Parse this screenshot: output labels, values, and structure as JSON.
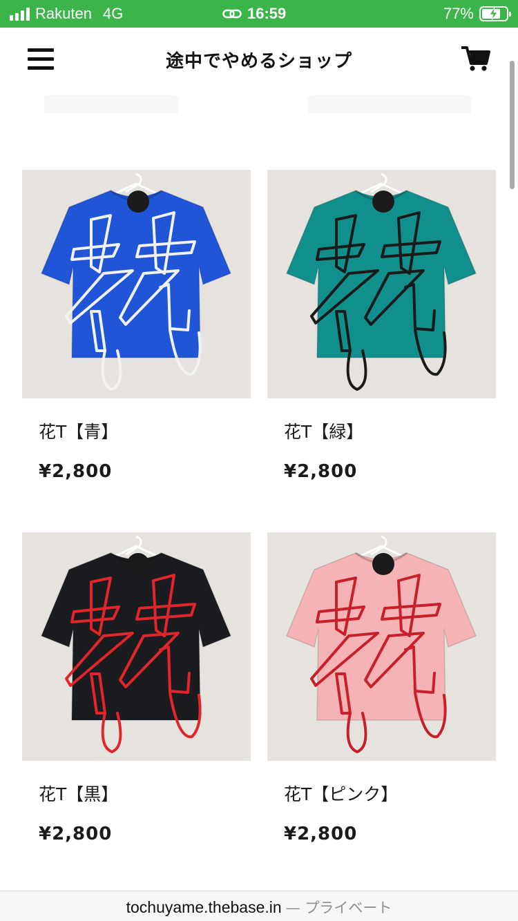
{
  "status_bar": {
    "carrier": "Rakuten",
    "network": "4G",
    "time": "16:59",
    "battery_percent_text": "77%",
    "battery_level": 0.77,
    "background_color": "#3bb54a",
    "icons": [
      "signal-icon",
      "link-icon",
      "battery-charging-icon"
    ]
  },
  "header": {
    "shop_name": "途中でやめるショップ",
    "menu_icon": "hamburger-menu-icon",
    "cart_icon": "shopping-cart-icon"
  },
  "products": [
    {
      "name": "花T【青】",
      "price": "¥2,800",
      "shirt_color": "#1f55d6",
      "stitch_color": "#f2f2f2"
    },
    {
      "name": "花T【緑】",
      "price": "¥2,800",
      "shirt_color": "#118f8c",
      "stitch_color": "#1a1a1a"
    },
    {
      "name": "花T【黒】",
      "price": "¥2,800",
      "shirt_color": "#1b1c20",
      "stitch_color": "#e0262a"
    },
    {
      "name": "花T【ピンク】",
      "price": "¥2,800",
      "shirt_color": "#f5b3b6",
      "stitch_color": "#c8202a"
    }
  ],
  "url_bar": {
    "host": "tochuyame.thebase.in",
    "suffix": "— プライベート"
  }
}
